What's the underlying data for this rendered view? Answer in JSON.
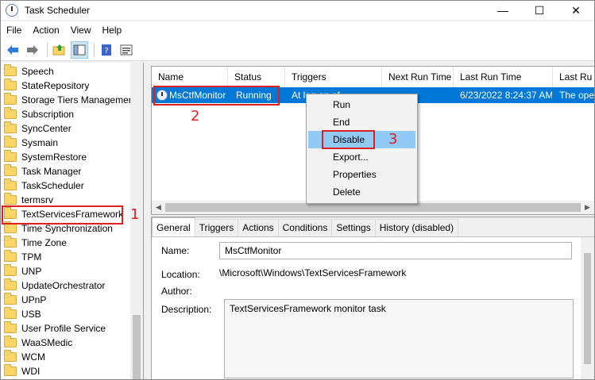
{
  "window": {
    "title": "Task Scheduler",
    "controls": {
      "minimize": "—",
      "maximize": "☐",
      "close": "✕"
    }
  },
  "menubar": {
    "items": [
      "File",
      "Action",
      "View",
      "Help"
    ]
  },
  "toolbar": {
    "icons": [
      "back-arrow-icon",
      "forward-arrow-icon",
      "folder-up-icon",
      "show-hide-console-tree-icon",
      "help-icon",
      "properties-icon"
    ]
  },
  "tree": {
    "items": [
      "Speech",
      "StateRepository",
      "Storage Tiers Managemer",
      "Subscription",
      "SyncCenter",
      "Sysmain",
      "SystemRestore",
      "Task Manager",
      "TaskScheduler",
      "termsrv",
      "TextServicesFramework",
      "Time Synchronization",
      "Time Zone",
      "TPM",
      "UNP",
      "UpdateOrchestrator",
      "UPnP",
      "USB",
      "User Profile Service",
      "WaaSMedic",
      "WCM",
      "WDI"
    ],
    "selected": "TextServicesFramework"
  },
  "task_list": {
    "columns": [
      "Name",
      "Status",
      "Triggers",
      "Next Run Time",
      "Last Run Time",
      "Last Ru"
    ],
    "rows": [
      {
        "name": "MsCtfMonitor",
        "status": "Running",
        "triggers": "At log on of",
        "next_run": "",
        "last_run": "6/23/2022 8:24:37 AM",
        "last_result": "The ope"
      }
    ]
  },
  "context_menu": {
    "items": [
      "Run",
      "End",
      "Disable",
      "Export...",
      "Properties",
      "Delete"
    ],
    "highlighted": "Disable"
  },
  "details": {
    "tabs": [
      "General",
      "Triggers",
      "Actions",
      "Conditions",
      "Settings",
      "History (disabled)"
    ],
    "active_tab": "General",
    "name_label": "Name:",
    "name_value": "MsCtfMonitor",
    "location_label": "Location:",
    "location_value": "\\Microsoft\\Windows\\TextServicesFramework",
    "author_label": "Author:",
    "author_value": "",
    "description_label": "Description:",
    "description_value": "TextServicesFramework monitor task"
  },
  "annotations": [
    "1",
    "2",
    "3"
  ],
  "colors": {
    "selection": "#0078d7",
    "menu_hover": "#91c9f7",
    "annotation_red": "#e02020"
  }
}
